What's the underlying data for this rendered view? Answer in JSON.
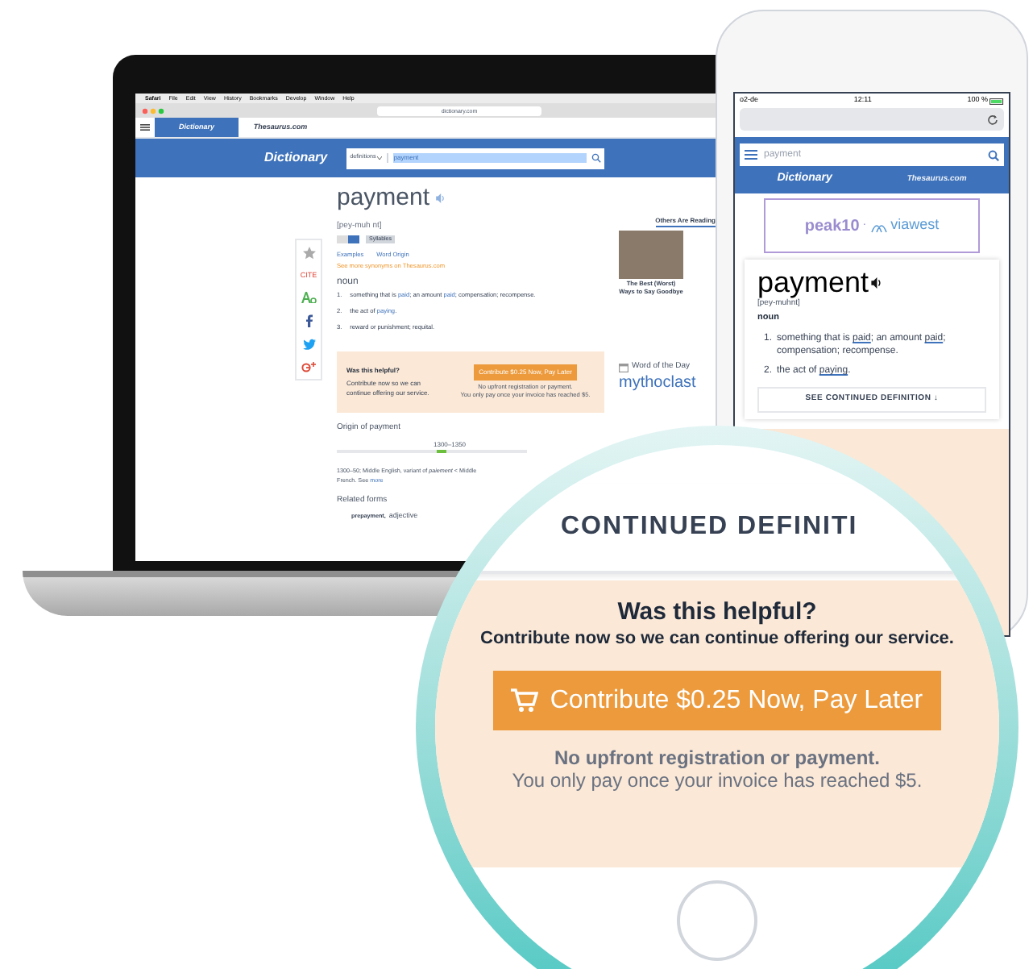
{
  "laptop": {
    "menu_bar": [
      "Safari",
      "File",
      "Edit",
      "View",
      "History",
      "Bookmarks",
      "Develop",
      "Window",
      "Help"
    ],
    "address": "dictionary.com",
    "tabs": [
      {
        "label": "Dictionary",
        "selected": true
      },
      {
        "label": "Thesaurus.com",
        "selected": false
      }
    ],
    "header": {
      "logo": "Dictionary",
      "search_scope": "definitions",
      "search_value": "payment"
    },
    "share": [
      {
        "kind": "star"
      },
      {
        "kind": "cite",
        "label": "CITE"
      },
      {
        "kind": "text-size"
      },
      {
        "kind": "facebook"
      },
      {
        "kind": "twitter"
      },
      {
        "kind": "google-plus"
      }
    ],
    "entry": {
      "word": "payment",
      "pronunciation": "[pey-muh nt]",
      "syllables_button": "Syllables",
      "links": [
        "Examples",
        "Word Origin"
      ],
      "synonyms_link": "See more synonyms on Thesaurus.com",
      "part_of_speech": "noun",
      "definitions": [
        {
          "number": "1.",
          "parts": [
            {
              "text": "something that is "
            },
            {
              "text": "paid",
              "link": true
            },
            {
              "text": "; an amount "
            },
            {
              "text": "paid",
              "link": true
            },
            {
              "text": "; compensation; recompense."
            }
          ]
        },
        {
          "number": "2.",
          "parts": [
            {
              "text": "the act of "
            },
            {
              "text": "paying",
              "link": true
            },
            {
              "text": "."
            }
          ]
        },
        {
          "number": "3.",
          "parts": [
            {
              "text": "reward or punishment; requital."
            }
          ]
        }
      ]
    },
    "helpful": {
      "title": "Was this helpful?",
      "text": "Contribute now so we can continue offering our service.",
      "button": "Contribute $0.25 Now, Pay Later",
      "note_1": "No upfront registration or payment.",
      "note_2": "You only pay once your invoice has reached $5."
    },
    "origin": {
      "heading": "Origin of payment",
      "period": "1300–1350",
      "text": "1300–50; Middle English, variant of *paiement* < Middle French. See",
      "link": "more"
    },
    "related_forms": {
      "heading": "Related forms",
      "word": "prepayment,",
      "part_of_speech": "adjective"
    },
    "sidebar": {
      "heading": "Others Are Reading",
      "articles": [
        {
          "caption": "The Best (Worst) Ways to Say Goodbye"
        }
      ]
    },
    "word_of_the_day": {
      "label": "Word of the Day",
      "word": "mythoclast"
    }
  },
  "phone": {
    "status": {
      "carrier": "o2-de",
      "time": "12:11",
      "battery": "100 %"
    },
    "search": {
      "placeholder": "payment"
    },
    "tabs": [
      {
        "label": "Dictionary",
        "selected": true
      },
      {
        "label": "Thesaurus.com",
        "selected": false
      }
    ],
    "ad": {
      "brand_1": "peak10",
      "separator": "·",
      "brand_2": "viawest"
    },
    "entry": {
      "word": "payment",
      "pronunciation": "[pey-muhnt]",
      "part_of_speech": "noun",
      "definitions": [
        {
          "number": "1.",
          "parts": [
            {
              "text": "something that is "
            },
            {
              "text": "paid",
              "link": true
            },
            {
              "text": "; an amount "
            },
            {
              "text": "paid",
              "link": true
            },
            {
              "text": "; compensation; recompense."
            }
          ]
        },
        {
          "number": "2.",
          "parts": [
            {
              "text": "the act of "
            },
            {
              "text": "paying",
              "link": true
            },
            {
              "text": "."
            }
          ]
        }
      ]
    },
    "more_button": "SEE CONTINUED DEFINITION ↓"
  },
  "magnifier": {
    "heading": "CONTINUED DEFINITI",
    "title": "Was this helpful?",
    "text": "Contribute now so we can continue offering our service.",
    "button": "Contribute $0.25 Now, Pay Later",
    "note_1": "No upfront registration or payment.",
    "note_2": "You only pay once your invoice has reached $5."
  }
}
